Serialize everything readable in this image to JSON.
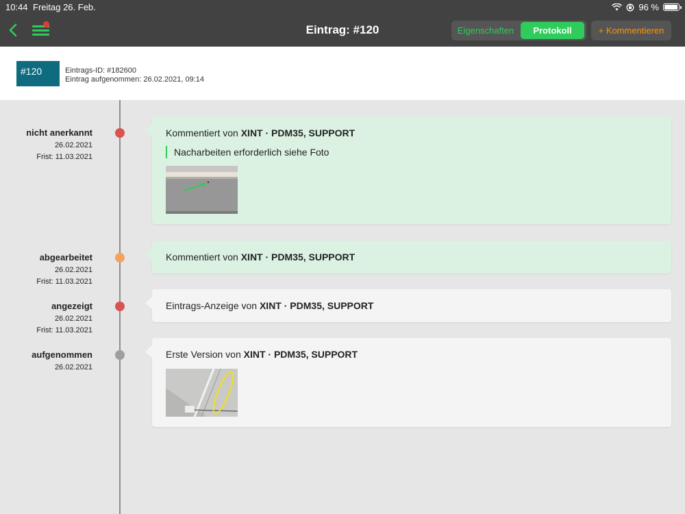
{
  "statusbar": {
    "time": "10:44",
    "date": "Freitag 26. Feb.",
    "battery": "96 %",
    "battery_level": 0.96
  },
  "nav": {
    "title": "Eintrag: #120",
    "tab_properties": "Eigenschaften",
    "tab_protocol": "Protokoll",
    "comment_button": "+ Kommentieren"
  },
  "entry": {
    "badge": "#120",
    "id_line": "Eintrags-ID: #182600",
    "recorded_line": "Eintrag aufgenommen: 26.02.2021, 09:14"
  },
  "colors": {
    "accent": "#2ecc5a",
    "topbar": "#424242",
    "badge": "#0f6c80",
    "orange_action": "#ff9500"
  },
  "timeline": [
    {
      "status": "nicht anerkannt",
      "date": "26.02.2021",
      "deadline": "Frist: 11.03.2021",
      "dot_color": "#d9534f",
      "card_prefix": "Kommentiert von ",
      "card_author": "XINT · PDM35, SUPPORT",
      "quote": "Nacharbeiten erforderlich siehe Foto",
      "card_style": "green"
    },
    {
      "status": "abgearbeitet",
      "date": "26.02.2021",
      "deadline": "Frist: 11.03.2021",
      "dot_color": "#f5a25d",
      "card_prefix": "Kommentiert von ",
      "card_author": "XINT · PDM35, SUPPORT",
      "card_style": "green"
    },
    {
      "status": "angezeigt",
      "date": "26.02.2021",
      "deadline": "Frist: 11.03.2021",
      "dot_color": "#d9534f",
      "card_prefix": "Eintrags-Anzeige von ",
      "card_author": "XINT · PDM35, SUPPORT",
      "card_style": "grey"
    },
    {
      "status": "aufgenommen",
      "date": "26.02.2021",
      "dot_color": "#9e9e9e",
      "card_prefix": "Erste Version von ",
      "card_author": "XINT · PDM35, SUPPORT",
      "card_style": "grey"
    }
  ]
}
